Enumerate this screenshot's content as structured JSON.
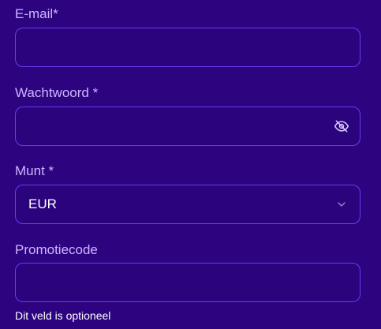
{
  "form": {
    "email": {
      "label": "E-mail*",
      "value": ""
    },
    "password": {
      "label": "Wachtwoord *",
      "value": "",
      "toggle_icon": "eye-slash-icon"
    },
    "currency": {
      "label": "Munt *",
      "selected": "EUR",
      "dropdown_icon": "chevron-down-icon"
    },
    "promo_code": {
      "label": "Promotiecode",
      "value": "",
      "hint": "Dit veld is optioneel"
    }
  },
  "colors": {
    "background": "#2d0380",
    "label": "#cdb6ff",
    "field_border": "#6a3cf3",
    "text": "#ffffff"
  }
}
